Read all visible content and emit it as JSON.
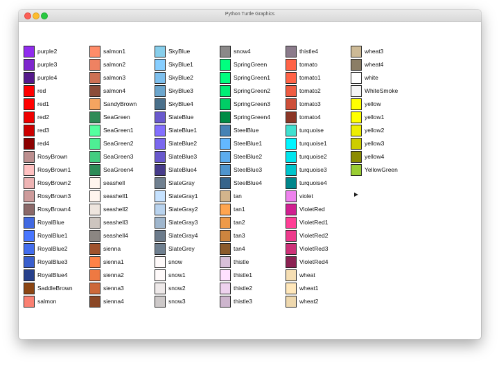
{
  "window": {
    "title": "Python Turtle Graphics"
  },
  "columns": [
    [
      {
        "name": "purple2",
        "color": "#912cee"
      },
      {
        "name": "purple3",
        "color": "#7d26cd"
      },
      {
        "name": "purple4",
        "color": "#551a8b"
      },
      {
        "name": "red",
        "color": "#ff0000"
      },
      {
        "name": "red1",
        "color": "#ff0000"
      },
      {
        "name": "red2",
        "color": "#ee0000"
      },
      {
        "name": "red3",
        "color": "#cd0000"
      },
      {
        "name": "red4",
        "color": "#8b0000"
      },
      {
        "name": "RosyBrown",
        "color": "#bc8f8f"
      },
      {
        "name": "RosyBrown1",
        "color": "#ffc1c1"
      },
      {
        "name": "RosyBrown2",
        "color": "#eeb4b4"
      },
      {
        "name": "RosyBrown3",
        "color": "#cd9b9b"
      },
      {
        "name": "RosyBrown4",
        "color": "#8b6969"
      },
      {
        "name": "RoyalBlue",
        "color": "#4169e1"
      },
      {
        "name": "RoyalBlue1",
        "color": "#4876ff"
      },
      {
        "name": "RoyalBlue2",
        "color": "#436eee"
      },
      {
        "name": "RoyalBlue3",
        "color": "#3a5fcd"
      },
      {
        "name": "RoyalBlue4",
        "color": "#27408b"
      },
      {
        "name": "SaddleBrown",
        "color": "#8b4513"
      },
      {
        "name": "salmon",
        "color": "#fa8072"
      }
    ],
    [
      {
        "name": "salmon1",
        "color": "#ff8c69"
      },
      {
        "name": "salmon2",
        "color": "#ee8262"
      },
      {
        "name": "salmon3",
        "color": "#cd7054"
      },
      {
        "name": "salmon4",
        "color": "#8b4c39"
      },
      {
        "name": "SandyBrown",
        "color": "#f4a460"
      },
      {
        "name": "SeaGreen",
        "color": "#2e8b57"
      },
      {
        "name": "SeaGreen1",
        "color": "#54ff9f"
      },
      {
        "name": "SeaGreen2",
        "color": "#4eee94"
      },
      {
        "name": "SeaGreen3",
        "color": "#43cd80"
      },
      {
        "name": "SeaGreen4",
        "color": "#2e8b57"
      },
      {
        "name": "seashell",
        "color": "#fff5ee"
      },
      {
        "name": "seashell1",
        "color": "#fff5ee"
      },
      {
        "name": "seashell2",
        "color": "#eee5de"
      },
      {
        "name": "seashell3",
        "color": "#cdc5bf"
      },
      {
        "name": "seashell4",
        "color": "#8b8682"
      },
      {
        "name": "sienna",
        "color": "#a0522d"
      },
      {
        "name": "sienna1",
        "color": "#ff8247"
      },
      {
        "name": "sienna2",
        "color": "#ee7942"
      },
      {
        "name": "sienna3",
        "color": "#cd6839"
      },
      {
        "name": "sienna4",
        "color": "#8b4726"
      }
    ],
    [
      {
        "name": "SkyBlue",
        "color": "#87ceeb"
      },
      {
        "name": "SkyBlue1",
        "color": "#87ceff"
      },
      {
        "name": "SkyBlue2",
        "color": "#7ec0ee"
      },
      {
        "name": "SkyBlue3",
        "color": "#6ca6cd"
      },
      {
        "name": "SkyBlue4",
        "color": "#4a708b"
      },
      {
        "name": "SlateBlue",
        "color": "#6a5acd"
      },
      {
        "name": "SlateBlue1",
        "color": "#836fff"
      },
      {
        "name": "SlateBlue2",
        "color": "#7a67ee"
      },
      {
        "name": "SlateBlue3",
        "color": "#6959cd"
      },
      {
        "name": "SlateBlue4",
        "color": "#473c8b"
      },
      {
        "name": "SlateGray",
        "color": "#708090"
      },
      {
        "name": "SlateGray1",
        "color": "#c6e2ff"
      },
      {
        "name": "SlateGray2",
        "color": "#b9d3ee"
      },
      {
        "name": "SlateGray3",
        "color": "#9fb6cd"
      },
      {
        "name": "SlateGray4",
        "color": "#6c7b8b"
      },
      {
        "name": "SlateGrey",
        "color": "#708090"
      },
      {
        "name": "snow",
        "color": "#fffafa"
      },
      {
        "name": "snow1",
        "color": "#fffafa"
      },
      {
        "name": "snow2",
        "color": "#eee9e9"
      },
      {
        "name": "snow3",
        "color": "#cdc9c9"
      }
    ],
    [
      {
        "name": "snow4",
        "color": "#8b8989"
      },
      {
        "name": "SpringGreen",
        "color": "#00ff7f"
      },
      {
        "name": "SpringGreen1",
        "color": "#00ff7f"
      },
      {
        "name": "SpringGreen2",
        "color": "#00ee76"
      },
      {
        "name": "SpringGreen3",
        "color": "#00cd66"
      },
      {
        "name": "SpringGreen4",
        "color": "#008b45"
      },
      {
        "name": "SteelBlue",
        "color": "#4682b4"
      },
      {
        "name": "SteelBlue1",
        "color": "#63b8ff"
      },
      {
        "name": "SteelBlue2",
        "color": "#5cacee"
      },
      {
        "name": "SteelBlue3",
        "color": "#4f94cd"
      },
      {
        "name": "SteelBlue4",
        "color": "#36648b"
      },
      {
        "name": "tan",
        "color": "#d2b48c"
      },
      {
        "name": "tan1",
        "color": "#ffa54f"
      },
      {
        "name": "tan2",
        "color": "#ee9a49"
      },
      {
        "name": "tan3",
        "color": "#cd853f"
      },
      {
        "name": "tan4",
        "color": "#8b5a2b"
      },
      {
        "name": "thistle",
        "color": "#d8bfd8"
      },
      {
        "name": "thistle1",
        "color": "#ffe1ff"
      },
      {
        "name": "thistle2",
        "color": "#eed2ee"
      },
      {
        "name": "thistle3",
        "color": "#cdb5cd"
      }
    ],
    [
      {
        "name": "thistle4",
        "color": "#8b7b8b"
      },
      {
        "name": "tomato",
        "color": "#ff6347"
      },
      {
        "name": "tomato1",
        "color": "#ff6347"
      },
      {
        "name": "tomato2",
        "color": "#ee5c42"
      },
      {
        "name": "tomato3",
        "color": "#cd4f39"
      },
      {
        "name": "tomato4",
        "color": "#8b3626"
      },
      {
        "name": "turquoise",
        "color": "#40e0d0"
      },
      {
        "name": "turquoise1",
        "color": "#00f5ff"
      },
      {
        "name": "turquoise2",
        "color": "#00e5ee"
      },
      {
        "name": "turquoise3",
        "color": "#00c5cd"
      },
      {
        "name": "turquoise4",
        "color": "#00868b"
      },
      {
        "name": "violet",
        "color": "#ee82ee"
      },
      {
        "name": "VioletRed",
        "color": "#d02090"
      },
      {
        "name": "VioletRed1",
        "color": "#ff3e96"
      },
      {
        "name": "VioletRed2",
        "color": "#ee3a8c"
      },
      {
        "name": "VioletRed3",
        "color": "#cd3278"
      },
      {
        "name": "VioletRed4",
        "color": "#8b2252"
      },
      {
        "name": "wheat",
        "color": "#f5deb3"
      },
      {
        "name": "wheat1",
        "color": "#ffe7ba"
      },
      {
        "name": "wheat2",
        "color": "#eed8ae"
      }
    ],
    [
      {
        "name": "wheat3",
        "color": "#cdba96"
      },
      {
        "name": "wheat4",
        "color": "#8b7e66"
      },
      {
        "name": "white",
        "color": "#ffffff"
      },
      {
        "name": "WhiteSmoke",
        "color": "#f5f5f5"
      },
      {
        "name": "yellow",
        "color": "#ffff00"
      },
      {
        "name": "yellow1",
        "color": "#ffff00"
      },
      {
        "name": "yellow2",
        "color": "#eeee00"
      },
      {
        "name": "yellow3",
        "color": "#cdcd00"
      },
      {
        "name": "yellow4",
        "color": "#8b8b00"
      },
      {
        "name": "YellowGreen",
        "color": "#9acd32"
      }
    ]
  ],
  "turtle": {
    "icon": "turtle-arrow-icon"
  }
}
